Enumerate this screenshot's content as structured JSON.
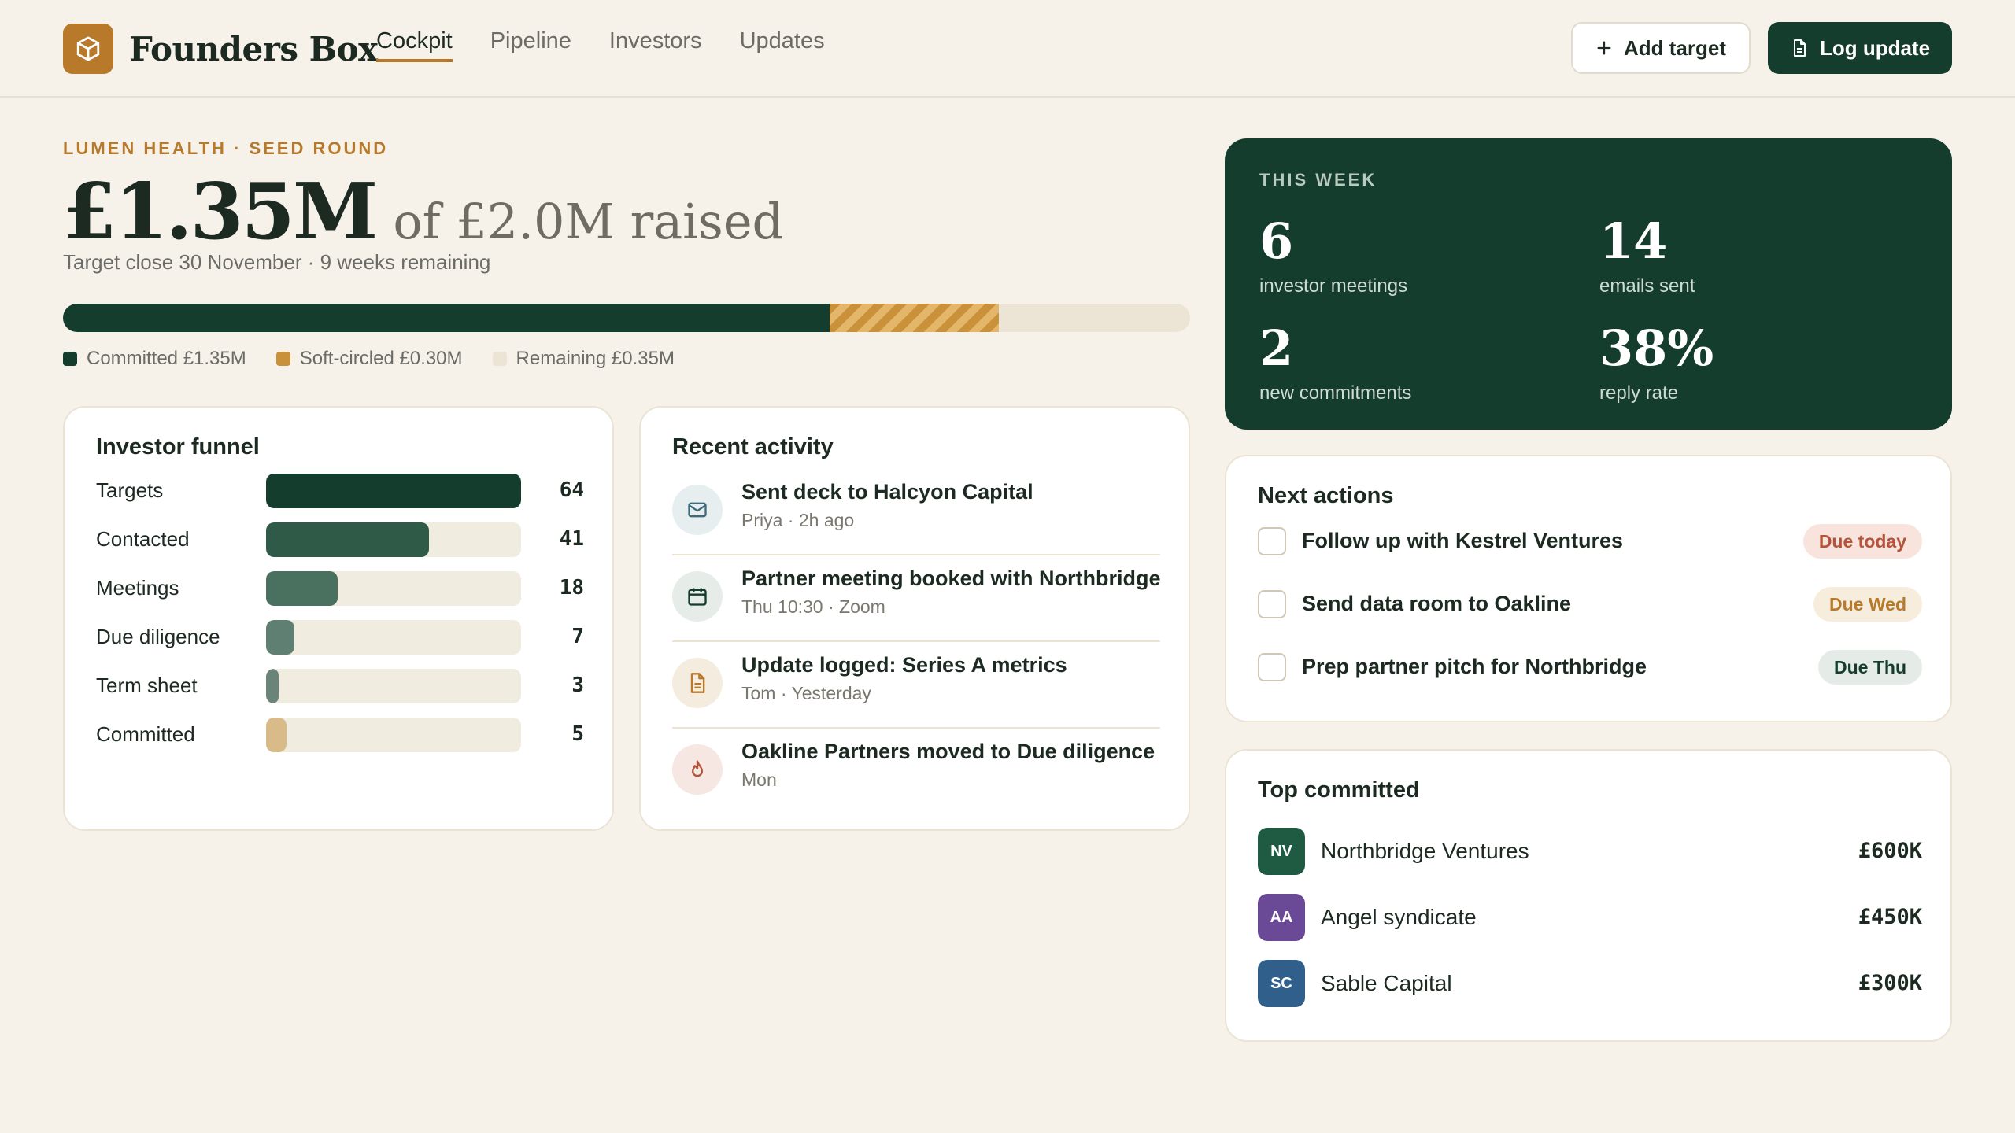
{
  "brand": {
    "name": "Founders Box",
    "logo_icon": "box-icon",
    "accent": "#b87a2a"
  },
  "nav": [
    {
      "label": "Cockpit",
      "active": true
    },
    {
      "label": "Pipeline",
      "active": false
    },
    {
      "label": "Investors",
      "active": false
    },
    {
      "label": "Updates",
      "active": false
    }
  ],
  "toolbar": {
    "add_target_label": "Add target",
    "log_update_label": "Log update"
  },
  "round": {
    "eyebrow": "LUMEN HEALTH · SEED ROUND",
    "raised": "£1.35M",
    "raised_of": "of £2.0M raised",
    "target_line": "Target close 30 November · 9 weeks remaining",
    "progress": {
      "committed_fraction": 0.68,
      "soft_fraction": 0.15
    },
    "legend": [
      {
        "label": "Committed £1.35M",
        "color": "#143d2e"
      },
      {
        "label": "Soft-circled £0.30M",
        "color": "#c9913a"
      },
      {
        "label": "Remaining £0.35M",
        "color": "#ece5d6"
      }
    ]
  },
  "funnel": {
    "title": "Investor funnel",
    "rows": [
      {
        "label": "Targets",
        "value": "64",
        "fraction": 1.0,
        "color": "#143d2e"
      },
      {
        "label": "Contacted",
        "value": "41",
        "fraction": 0.64,
        "color": "#2f5a47"
      },
      {
        "label": "Meetings",
        "value": "18",
        "fraction": 0.28,
        "color": "#4a7060"
      },
      {
        "label": "Due diligence",
        "value": "7",
        "fraction": 0.11,
        "color": "#5e7f71"
      },
      {
        "label": "Term sheet",
        "value": "3",
        "fraction": 0.05,
        "color": "#6b8479"
      },
      {
        "label": "Committed",
        "value": "5",
        "fraction": 0.08,
        "color": "#d8bb88"
      }
    ]
  },
  "activity": {
    "title": "Recent activity",
    "items": [
      {
        "title": "Sent deck to Halcyon Capital",
        "meta": "Priya · 2h ago",
        "icon": "mail-icon",
        "bg": "#e7eef0",
        "fg": "#3e6a7a"
      },
      {
        "title": "Partner meeting booked with Northbridge",
        "meta": "Thu 10:30 · Zoom",
        "icon": "calendar-icon",
        "bg": "#e6ece8",
        "fg": "#143d2e"
      },
      {
        "title": "Update logged: Series A metrics",
        "meta": "Tom · Yesterday",
        "icon": "document-icon",
        "bg": "#f5ece0",
        "fg": "#b87a2a"
      },
      {
        "title": "Oakline Partners moved to Due diligence",
        "meta": "Mon",
        "icon": "flame-icon",
        "bg": "#f6e7e2",
        "fg": "#b5533a"
      }
    ]
  },
  "week": {
    "label": "THIS WEEK",
    "stats": [
      {
        "value": "6",
        "label": "investor meetings"
      },
      {
        "value": "14",
        "label": "emails sent"
      },
      {
        "value": "2",
        "label": "new commitments"
      },
      {
        "value": "38%",
        "label": "reply rate"
      }
    ]
  },
  "actions": {
    "title": "Next actions",
    "items": [
      {
        "text": "Follow up with Kestrel Ventures",
        "badge": "Due today",
        "badge_bg": "#f8e4dc",
        "badge_fg": "#b5533a"
      },
      {
        "text": "Send data room to Oakline",
        "badge": "Due Wed",
        "badge_bg": "#f6eddd",
        "badge_fg": "#b87a2a"
      },
      {
        "text": "Prep partner pitch for Northbridge",
        "badge": "Due Thu",
        "badge_bg": "#e5ece8",
        "badge_fg": "#143d2e"
      }
    ]
  },
  "top_committed": {
    "title": "Top committed",
    "items": [
      {
        "initials": "NV",
        "name": "Northbridge Ventures",
        "amount": "£600K",
        "color": "#1f5a43"
      },
      {
        "initials": "AA",
        "name": "Angel syndicate",
        "amount": "£450K",
        "color": "#6a4a96"
      },
      {
        "initials": "SC",
        "name": "Sable Capital",
        "amount": "£300K",
        "color": "#2f5f8a"
      }
    ]
  }
}
